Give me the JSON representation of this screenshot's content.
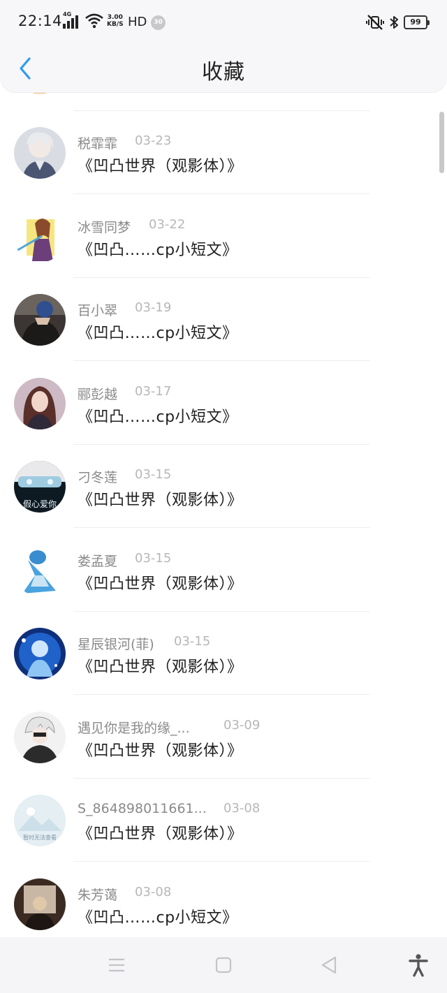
{
  "status_bar": {
    "time": "22:14",
    "network_type": "4G",
    "speed_value": "3.00",
    "speed_unit": "KB/S",
    "hd": "HD",
    "notification_count": "30",
    "battery": "99"
  },
  "nav": {
    "title": "收藏",
    "back_icon": "chevron-left-icon"
  },
  "colors": {
    "accent": "#2d9bf0",
    "name_text": "#8a8a8a",
    "date_text": "#b7b7b7",
    "title_text": "#1f1f1f"
  },
  "items": [
    {
      "name": "税霏霏",
      "date": "03-23",
      "title": "《凹凸世界（观影体）》"
    },
    {
      "name": "冰雪同梦",
      "date": "03-22",
      "title": "《凹凸……cp小短文》"
    },
    {
      "name": "百小翠",
      "date": "03-19",
      "title": "《凹凸……cp小短文》"
    },
    {
      "name": "郦彭越",
      "date": "03-17",
      "title": "《凹凸……cp小短文》"
    },
    {
      "name": "刁冬莲",
      "date": "03-15",
      "title": "《凹凸世界（观影体）》"
    },
    {
      "name": "娄孟夏",
      "date": "03-15",
      "title": "《凹凸世界（观影体）》"
    },
    {
      "name": "星辰银河(菲)",
      "date": "03-15",
      "title": "《凹凸世界（观影体）》"
    },
    {
      "name": "遇见你是我的缘_...",
      "date": "03-09",
      "title": "《凹凸世界（观影体）》"
    },
    {
      "name": "S_864898011661...",
      "date": "03-08",
      "title": "《凹凸世界（观影体）》"
    },
    {
      "name": "朱芳蔼",
      "date": "03-08",
      "title": "《凹凸……cp小短文》"
    }
  ],
  "avatar_texts": {
    "item5": "假心爱你",
    "item9": "暂时无法查看"
  },
  "system_nav": [
    "menu-icon",
    "home-square-icon",
    "back-triangle-icon",
    "accessibility-icon"
  ]
}
